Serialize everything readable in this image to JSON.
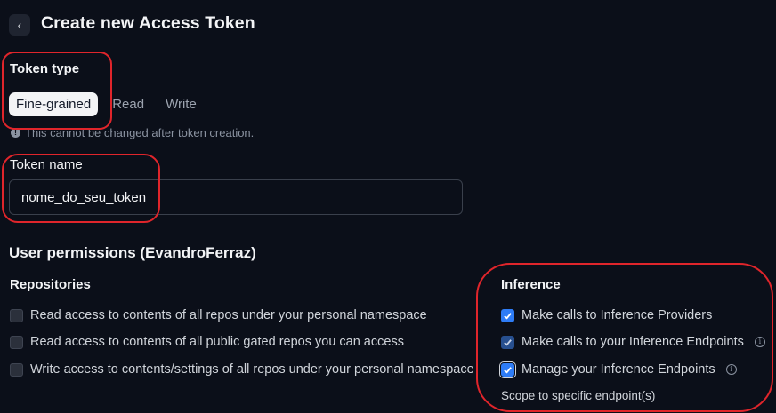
{
  "header": {
    "back_icon": "chevron-left-icon",
    "title": "Create new Access Token"
  },
  "token_type": {
    "label": "Token type",
    "tabs": [
      {
        "label": "Fine-grained",
        "selected": true
      },
      {
        "label": "Read",
        "selected": false
      },
      {
        "label": "Write",
        "selected": false
      }
    ],
    "hint_icon": "info-circle-icon",
    "hint": "This cannot be changed after token creation."
  },
  "token_name": {
    "label": "Token name",
    "value": "nome_do_seu_token"
  },
  "permissions": {
    "title": "User permissions (EvandroFerraz)",
    "repositories": {
      "label": "Repositories",
      "items": [
        {
          "label": "Read access to contents of all repos under your personal namespace",
          "checked": false
        },
        {
          "label": "Read access to contents of all public gated repos you can access",
          "checked": false
        },
        {
          "label": "Write access to contents/settings of all repos under your personal namespace",
          "checked": false
        }
      ]
    },
    "inference": {
      "label": "Inference",
      "items": [
        {
          "label": "Make calls to Inference Providers",
          "checked": true
        },
        {
          "label": "Make calls to your Inference Endpoints",
          "checked": true
        },
        {
          "label": "Manage your Inference Endpoints",
          "checked": true
        }
      ],
      "scope_link": "Scope to specific endpoint(s)"
    }
  },
  "colors": {
    "background": "#0b0f19",
    "accent": "#2e7cf6",
    "annotation": "#e0252b"
  }
}
